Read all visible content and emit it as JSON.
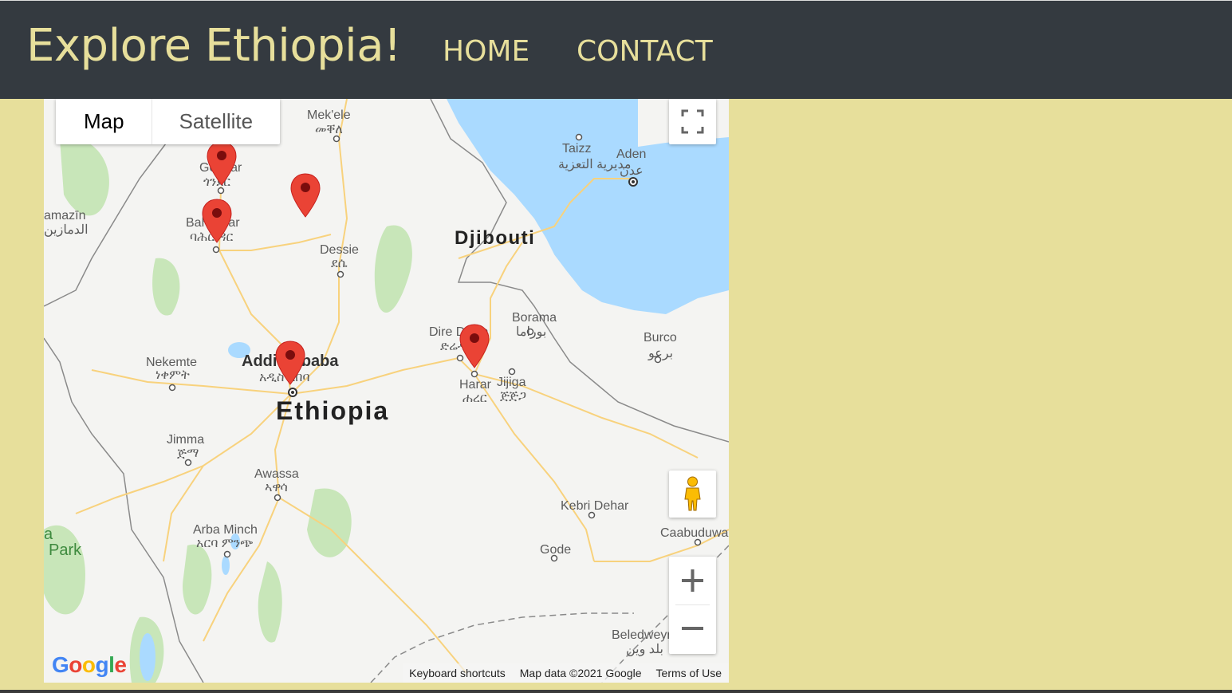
{
  "navbar": {
    "brand": "Explore Ethiopia!",
    "links": [
      {
        "label": "HOME"
      },
      {
        "label": "CONTACT"
      }
    ]
  },
  "map": {
    "map_type": {
      "map": "Map",
      "satellite": "Satellite",
      "selected": "Map"
    },
    "labels": {
      "mekele": "Mek'ele",
      "mekele_am": "መቐለ",
      "gondar": "Gondar",
      "gondar_am": "ጎንደር",
      "bahirdar": "Bahir Dar",
      "bahirdar_am": "ባሕር ዳር",
      "dessie": "Dessie",
      "dessie_am": "ደሴ",
      "damazin": "amazīn",
      "damazin_ar": "الدمازين",
      "addis": "Addis Ababa",
      "addis_am": "አዲስ አበባ",
      "nekemte": "Nekemte",
      "nekemte_am": "ነቀምት",
      "ethiopia": "Ethiopia",
      "djibouti": "Djibouti",
      "taizz": "Taizz",
      "taizz_ar": "مديرية التعزية",
      "aden": "Aden",
      "aden_ar": "عدن",
      "diredawa": "Dire Dawa",
      "diredawa_am": "ድሬዳዋ",
      "borama": "Borama",
      "borama_ar": "بوراما",
      "burco": "Burco",
      "burco_ar": "برعو",
      "harar": "Harar",
      "harar_am": "ሐረር",
      "jijiga": "Jijiga",
      "jijiga_am": "ጅጅጋ",
      "jimma": "Jimma",
      "jimma_am": "ጅማ",
      "awassa": "Awassa",
      "awassa_am": "ኣዋሳ",
      "arbaminch": "Arba Minch",
      "arbaminch_am": "አርባ ምንጭ",
      "park": "Park",
      "park_a": "a",
      "kebridehar": "Kebri Dehar",
      "caabuduwaaq": "Caabuduwaaq",
      "gode": "Gode",
      "beledweyne": "Beledweyne",
      "beledweyne_ar": "بلد وين"
    },
    "footer": {
      "shortcuts": "Keyboard shortcuts",
      "data": "Map data ©2021 Google",
      "terms": "Terms of Use"
    },
    "logo": "Google",
    "colors": {
      "water": "#aadaff",
      "green": "#c8e6b9",
      "road": "#f8d27d",
      "marker": "#ea4335"
    }
  }
}
